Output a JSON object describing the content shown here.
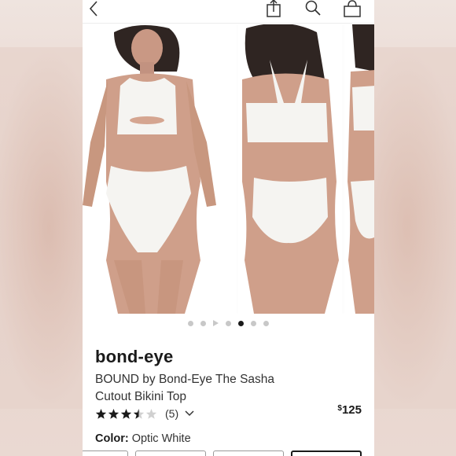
{
  "toolbar": {
    "back_icon": "chevron-left-icon",
    "share_icon": "share-icon",
    "search_icon": "search-icon",
    "bag_icon": "shopping-bag-icon"
  },
  "gallery": {
    "image_count": 7,
    "active_index": 4,
    "video_index": 2
  },
  "product": {
    "brand": "bond-eye",
    "title": "BOUND by Bond-Eye The Sasha Cutout Bikini Top",
    "rating": 3.5,
    "rating_max": 5,
    "review_count": "(5)",
    "price_symbol": "$",
    "price_amount": "125"
  },
  "color": {
    "label": "Color:",
    "value": "Optic White"
  },
  "colors": {
    "accent": "#1a1a1a",
    "dot_inactive": "#c8c8c8",
    "background": "#ffffff"
  }
}
